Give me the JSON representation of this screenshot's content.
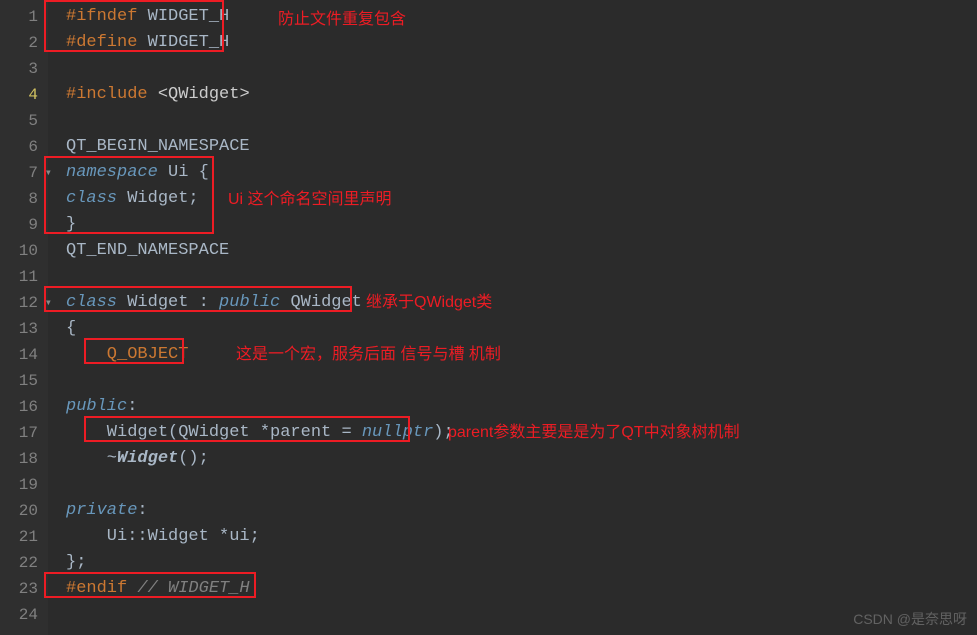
{
  "lines": {
    "n1": "1",
    "n2": "2",
    "n3": "3",
    "n4": "4",
    "n5": "5",
    "n6": "6",
    "n7": "7",
    "n8": "8",
    "n9": "9",
    "n10": "10",
    "n11": "11",
    "n12": "12",
    "n13": "13",
    "n14": "14",
    "n15": "15",
    "n16": "16",
    "n17": "17",
    "n18": "18",
    "n19": "19",
    "n20": "20",
    "n21": "21",
    "n22": "22",
    "n23": "23",
    "n24": "24"
  },
  "code": {
    "l1_pp": "#ifndef",
    "l1_m": " WIDGET_H",
    "l2_pp": "#define",
    "l2_m": " WIDGET_H",
    "l4_pp": "#include",
    "l4_a": " <QWidget>",
    "l6": "QT_BEGIN_NAMESPACE",
    "l7_kw": "namespace",
    "l7_b": " Ui {",
    "l8_kw": "class",
    "l8_b": " Widget;",
    "l9": "}",
    "l10": "QT_END_NAMESPACE",
    "l12_kw": "class",
    "l12_n": " Widget : ",
    "l12_pub": "public",
    "l12_q": " QWidget",
    "l13": "{",
    "l14": "    Q_OBJECT",
    "l16_kw": "public",
    "l16_c": ":",
    "l17_a": "    Widget(QWidget *parent = ",
    "l17_null": "nullptr",
    "l17_b": ");",
    "l18_a": "    ~",
    "l18_d": "Widget",
    "l18_b": "();",
    "l19": "",
    "l20_kw": "private",
    "l20_c": ":",
    "l21": "    Ui::Widget *ui;",
    "l22": "};",
    "l23_pp": "#endif",
    "l23_cmt": " // WIDGET_H"
  },
  "annotations": {
    "a1": "防止文件重复包含",
    "a2": "Ui 这个命名空间里声明",
    "a3": "继承于QWidget类",
    "a4": "这是一个宏，服务后面 信号与槽 机制",
    "a5": "parent参数主要是是为了QT中对象树机制"
  },
  "watermark": "CSDN @是奈思呀"
}
